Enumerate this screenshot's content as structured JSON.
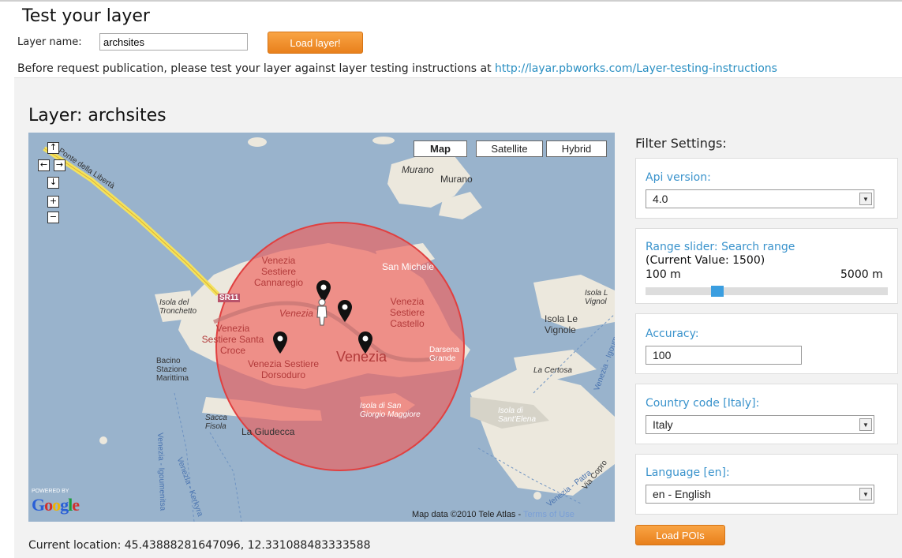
{
  "header": {
    "title": "Test your layer",
    "layer_name_label": "Layer name:",
    "layer_name_value": "archsites",
    "load_layer_button": "Load layer!",
    "note_text": "Before request publication, please test your layer against layer testing instructions at ",
    "note_link": "http://layar.pbworks.com/Layer-testing-instructions"
  },
  "layer": {
    "title": "Layer: archsites"
  },
  "map": {
    "types": [
      "Map",
      "Satellite",
      "Hybrid"
    ],
    "selected_type": "Map",
    "nav": {
      "up": "↑",
      "left": "←",
      "right": "→",
      "down": "↓",
      "zoom_in": "+",
      "zoom_out": "−"
    },
    "labels": {
      "ponte": "Ponte della Libertà",
      "murano1": "Murano",
      "murano2": "Murano",
      "cannaregio": "Venezia Sestiere Cannaregio",
      "san_michele": "San Michele",
      "sr11": "SR11",
      "tronchetto": "Isola del Tronchetto",
      "venezia_small": "Venezia",
      "castello": "Venezia Sestiere Castello",
      "isola_vignole_a": "Isola L Vignol",
      "isola_vignole_b": "Isola Le Vignole",
      "santa_croce": "Venezia Sestiere Santa Croce",
      "bacino": "Bacino Stazione Marittima",
      "dorsoduro": "Venezia Sestiere Dorsoduro",
      "venezia_big": "Venezia",
      "darsena": "Darsena Grande",
      "certosa": "La Certosa",
      "san_giorgio": "Isola di San Giorgio Maggiore",
      "sant_elena": "Isola di Sant'Elena",
      "sacca_fisola": "Sacca Fisola",
      "giudecca": "La Giudecca",
      "vetrerie": "Venezia - Igoumenitsa",
      "patra": "Venezia - Patra",
      "kerkyra": "Venezia - Kerkyra",
      "venezia_igo": "Venezia - Igoumenitsa",
      "via_copro": "Via Copro"
    },
    "powered_by": "POWERED BY",
    "google": "Google",
    "map_data": "Map data ©2010 Tele Atlas - ",
    "terms": "Terms of Use"
  },
  "current_location": "Current location: 45.43888281647096, 12.331088483333588",
  "filters": {
    "heading": "Filter Settings:",
    "api_label": "Api version:",
    "api_value": "4.0",
    "range_label": "Range slider: Search range",
    "range_current": "(Current Value: 1500)",
    "range_min": "100 m",
    "range_max": "5000 m",
    "range_value": 1500,
    "accuracy_label": "Accuracy:",
    "accuracy_value": "100",
    "country_label": "Country code [Italy]:",
    "country_value": "Italy",
    "language_label": "Language [en]:",
    "language_value": "en - English",
    "load_pois_button": "Load POIs"
  },
  "colors": {
    "water": "#99b3cc",
    "land": "#ece8dd",
    "radius_fill": "#f0605a",
    "link": "#2a8fc2",
    "label_blue": "#3a93cc",
    "button_orange": "#f39432"
  }
}
